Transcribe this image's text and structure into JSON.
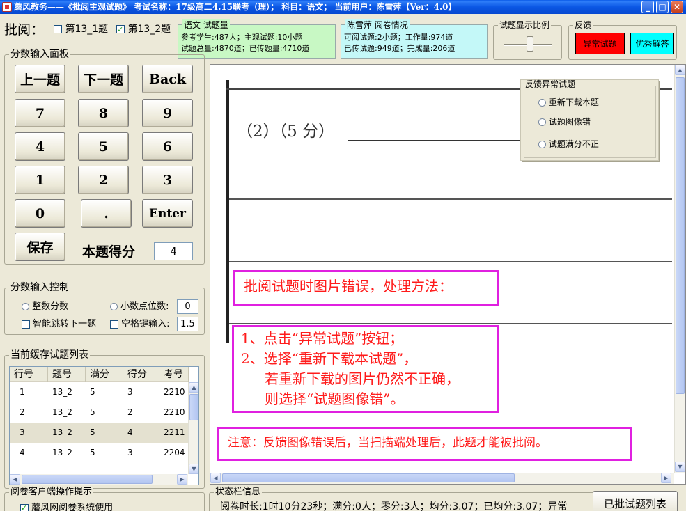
{
  "window": {
    "title": "蘑风教务——《批阅主观试题》 考试名称：17级高二4.15联考（理）； 科目：语文； 当前用户：陈雪萍【Ver：4.0】",
    "min_glyph": "_",
    "max_glyph": "□",
    "close_glyph": "✕"
  },
  "mark_selector": {
    "label": "批阅：",
    "options": [
      {
        "label": "第13_1题",
        "checked": false
      },
      {
        "label": "第13_2题",
        "checked": true
      }
    ]
  },
  "subject_panel": {
    "title": "语文 试题量",
    "line1": "参考学生:487人；主观试题:10小题",
    "line2": "试题总量:4870道；已传题量:4710道"
  },
  "reader_panel": {
    "title": "陈雪萍 阅卷情况",
    "line1": "可阅试题:2小题；工作量:974道",
    "line2": "已传试题:949道；完成量:206道"
  },
  "zoom_group": {
    "title": "试题显示比例"
  },
  "feedback_group": {
    "title": "反馈",
    "abnormal_label": "异常试题",
    "excellent_label": "优秀解答",
    "abnormal_color": "#ff0000",
    "excellent_color": "#00ffff"
  },
  "score_panel": {
    "title": "分数输入面板",
    "prev_label": "上一题",
    "next_label": "下一题",
    "back_label": "Back",
    "keys": [
      "7",
      "8",
      "9",
      "4",
      "5",
      "6",
      "1",
      "2",
      "3",
      "0",
      "."
    ],
    "enter_label": "Enter",
    "save_label": "保存",
    "score_label": "本题得分",
    "score_value": "4"
  },
  "score_control": {
    "title": "分数输入控制",
    "integer_label": "整数分数",
    "decimal_label": "小数点位数:",
    "decimal_value": "0",
    "auto_next_label": "智能跳转下一题",
    "space_label": "空格键输入:",
    "space_value": "1.5"
  },
  "cache_list": {
    "title": "当前缓存试题列表",
    "columns": [
      "行号",
      "题号",
      "满分",
      "得分",
      "考号"
    ],
    "rows": [
      [
        "1",
        "13_2",
        "5",
        "3",
        "2210"
      ],
      [
        "2",
        "13_2",
        "5",
        "2",
        "2210"
      ],
      [
        "3",
        "13_2",
        "5",
        "4",
        "2211"
      ],
      [
        "4",
        "13_2",
        "5",
        "3",
        "2204"
      ]
    ]
  },
  "client_tips": {
    "title": "阅卷客户端操作提示",
    "item_label": "蘑风网阅卷系统使用"
  },
  "viewer": {
    "question_label": "（2）（5 分）",
    "abnormal_popup": {
      "title": "反馈异常试题",
      "options": [
        "重新下载本题",
        "试题图像错",
        "试题满分不正"
      ]
    },
    "tip_header": "批阅试题时图片错误，处理方法：",
    "tip_steps": [
      "1、点击“异常试题”按钮；",
      "2、选择“重新下载本试题”，",
      "若重新下载的图片仍然不正确，",
      "则选择“试题图像错”。"
    ],
    "tip_note": "注意：反馈图像错误后，当扫描端处理后，此题才能被批阅。"
  },
  "status_bar": {
    "title": "状态栏信息",
    "text": "阅卷时长:1时10分23秒；满分:0人；零分:3人；均分:3.07；已均分:3.07；异常",
    "batch_list_label": "已批试题列表"
  }
}
